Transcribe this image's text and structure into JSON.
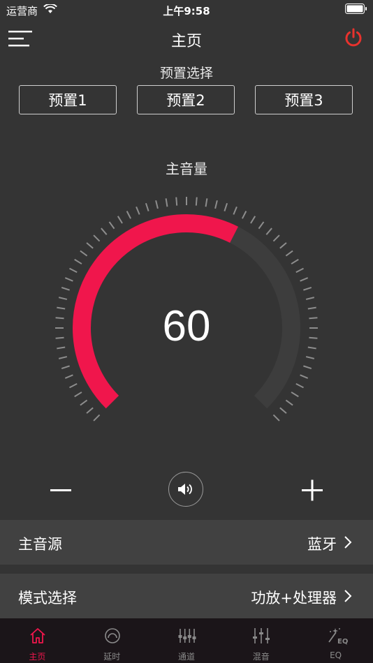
{
  "status_bar": {
    "carrier": "运营商",
    "time": "上午9:58"
  },
  "nav": {
    "title": "主页"
  },
  "presets": {
    "label": "预置选择",
    "items": [
      "预置1",
      "预置2",
      "预置3"
    ]
  },
  "volume": {
    "label": "主音量",
    "value": "60",
    "level_percent": 60
  },
  "rows": [
    {
      "label": "主音源",
      "value": "蓝牙"
    },
    {
      "label": "模式选择",
      "value": "功放+处理器"
    }
  ],
  "tabs": [
    {
      "label": "主页",
      "icon": "home-icon",
      "active": true
    },
    {
      "label": "延时",
      "icon": "delay-icon",
      "active": false
    },
    {
      "label": "通道",
      "icon": "channel-icon",
      "active": false
    },
    {
      "label": "混音",
      "icon": "mixer-icon",
      "active": false
    },
    {
      "label": "EQ",
      "icon": "eq-icon",
      "active": false
    }
  ],
  "colors": {
    "accent": "#f0164c",
    "power": "#e8322d",
    "background": "#343434",
    "track": "#3d3d3d"
  }
}
